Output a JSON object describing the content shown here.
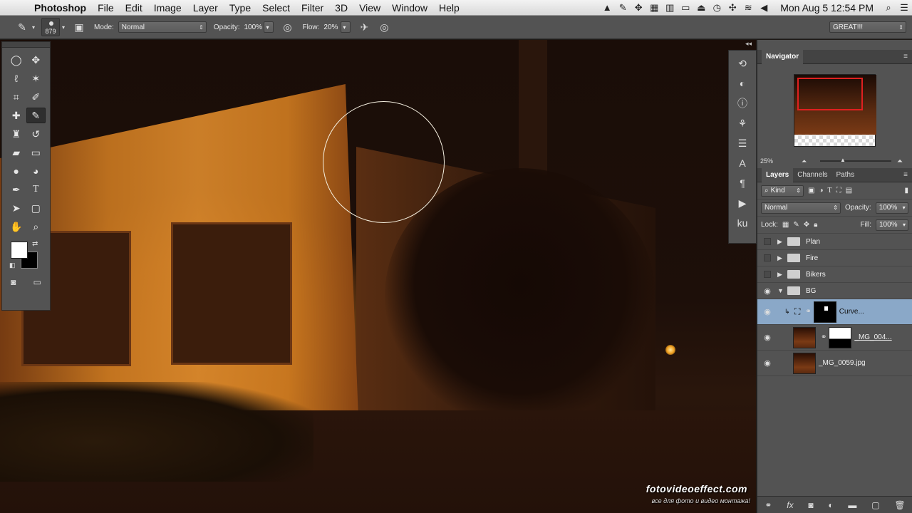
{
  "menubar": {
    "app_name": "Photoshop",
    "items": [
      "File",
      "Edit",
      "Image",
      "Layer",
      "Type",
      "Select",
      "Filter",
      "3D",
      "View",
      "Window",
      "Help"
    ],
    "clock": "Mon Aug 5  12:54 PM"
  },
  "options": {
    "brush_size": "879",
    "mode_label": "Mode:",
    "mode_value": "Normal",
    "opacity_label": "Opacity:",
    "opacity_value": "100%",
    "flow_label": "Flow:",
    "flow_value": "20%",
    "workspace": "GREAT!!!"
  },
  "watermark": {
    "line1": "fotovideoeffect.com",
    "line2": "все для фото и видео монтажа!"
  },
  "navigator": {
    "title": "Navigator",
    "zoom": "25%"
  },
  "layers_panel": {
    "tabs": [
      "Layers",
      "Channels",
      "Paths"
    ],
    "kind_label": "Kind",
    "blend_mode": "Normal",
    "opacity_label": "Opacity:",
    "opacity_value": "100%",
    "lock_label": "Lock:",
    "fill_label": "Fill:",
    "fill_value": "100%",
    "layers": [
      {
        "name": "Plan"
      },
      {
        "name": "Fire"
      },
      {
        "name": "Bikers"
      },
      {
        "name": "BG"
      },
      {
        "name": "Curve..."
      },
      {
        "name": "_MG_004..."
      },
      {
        "name": "_MG_0059.jpg"
      }
    ]
  },
  "colors": {
    "accent_selection": "#8aa8c8",
    "brush_cursor": "#f5f0e0",
    "navigator_frame": "#e02020"
  }
}
